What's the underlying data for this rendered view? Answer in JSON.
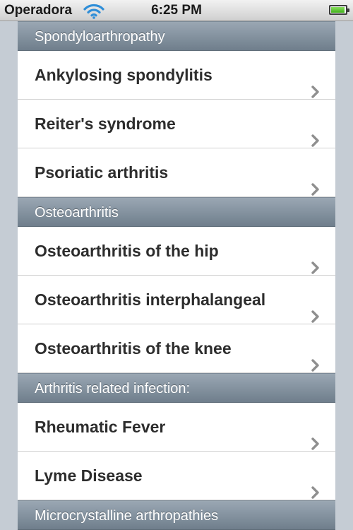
{
  "status_bar": {
    "carrier": "Operadora",
    "time": "6:25 PM",
    "battery_level": 0.95,
    "wifi_icon": "wifi-icon",
    "battery_icon": "battery-icon"
  },
  "colors": {
    "section_header": "#7f8d9b",
    "row_background": "#ffffff",
    "chevron": "#8f8f8f"
  },
  "sections": [
    {
      "title": "Spondyloarthropathy",
      "items": [
        "Ankylosing spondylitis",
        "Reiter's syndrome",
        "Psoriatic arthritis"
      ]
    },
    {
      "title": "Osteoarthritis",
      "items": [
        "Osteoarthritis of the hip",
        "Osteoarthritis interphalangeal",
        "Osteoarthritis of the knee"
      ]
    },
    {
      "title": "Arthritis related infection:",
      "items": [
        "Rheumatic Fever",
        "Lyme Disease"
      ]
    },
    {
      "title": "Microcrystalline arthropathies",
      "items": []
    }
  ]
}
